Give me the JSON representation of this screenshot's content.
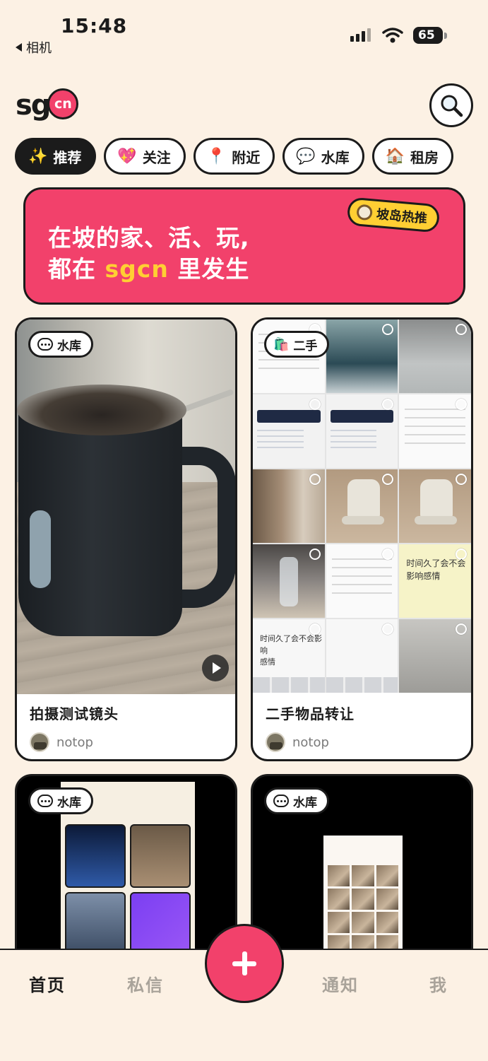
{
  "status_bar": {
    "time": "15:48",
    "back_app": "相机",
    "battery": "65"
  },
  "header": {
    "logo_main": "sg",
    "logo_badge": "cn"
  },
  "tabs": [
    {
      "icon": "✨",
      "icon_name": "sparkles-icon",
      "label": "推荐",
      "active": true
    },
    {
      "icon": "💖",
      "icon_name": "heart-icon",
      "label": "关注",
      "active": false
    },
    {
      "icon": "📍",
      "icon_name": "pin-icon",
      "label": "附近",
      "active": false
    },
    {
      "icon": "💬",
      "icon_name": "speech-bubble-icon",
      "label": "水库",
      "active": false
    },
    {
      "icon": "🏠",
      "icon_name": "house-icon",
      "label": "租房",
      "active": false
    }
  ],
  "banner": {
    "line1": "在坡的家、活、玩,",
    "line2_prefix": "都在 ",
    "line2_highlight": "sgcn",
    "line2_suffix": " 里发生",
    "badge": "坡岛热推"
  },
  "posts": [
    {
      "chip": "水库",
      "title": "拍摄测试镜头",
      "author": "notop",
      "is_video": true
    },
    {
      "chip": "二手",
      "title": "二手物品转让",
      "author": "notop",
      "is_video": false
    },
    {
      "chip": "水库"
    },
    {
      "chip": "水库"
    }
  ],
  "collage_text": {
    "note_1": "时间久了会不会",
    "note_2": "影响感情",
    "kbd_1": "时间久了会不会影响",
    "kbd_2": "感情"
  },
  "bottom_nav": {
    "home": "首页",
    "messages": "私信",
    "notifications": "通知",
    "me": "我"
  },
  "colors": {
    "background": "#fcf1e4",
    "accent": "#f2416b",
    "highlight": "#ffcf33",
    "ink": "#1b1b1b"
  }
}
